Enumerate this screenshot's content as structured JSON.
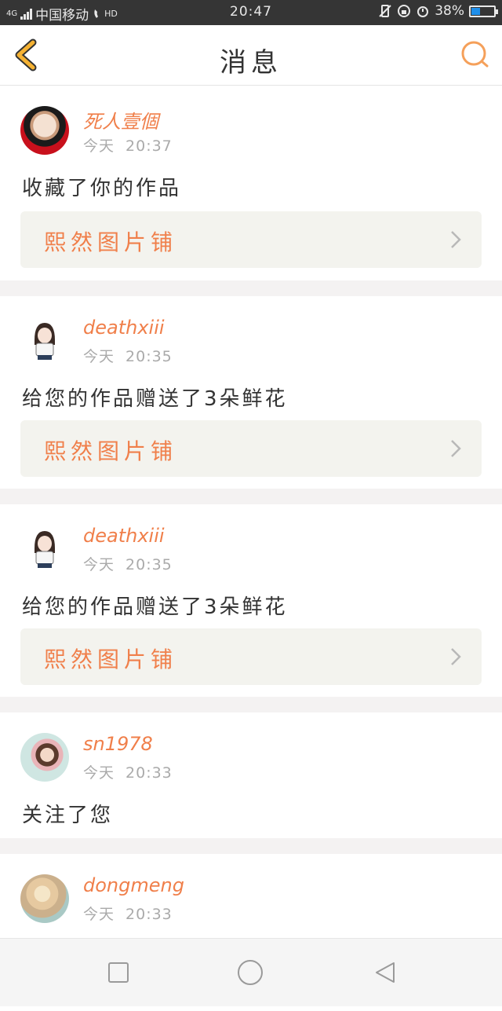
{
  "status_bar": {
    "network": "4G",
    "carrier": "中国移动",
    "hd": "HD",
    "time": "20:47",
    "battery": "38%",
    "battery_level": 0.38
  },
  "header": {
    "title": "消息",
    "back_icon": "chevron-left-icon",
    "search_icon": "search-icon"
  },
  "notifications": [
    {
      "user": "死人壹個",
      "day": "今天",
      "time": "20:37",
      "message": "收藏了你的作品",
      "link": "熙然图片铺",
      "avatar": "red-portrait"
    },
    {
      "user": "deathxiii",
      "day": "今天",
      "time": "20:35",
      "message": "给您的作品赠送了3朵鲜花",
      "link": "熙然图片铺",
      "avatar": "cartoon-girl"
    },
    {
      "user": "deathxiii",
      "day": "今天",
      "time": "20:35",
      "message": "给您的作品赠送了3朵鲜花",
      "link": "熙然图片铺",
      "avatar": "cartoon-girl"
    },
    {
      "user": "sn1978",
      "day": "今天",
      "time": "20:33",
      "message": "关注了您",
      "avatar": "illustrated-girl"
    },
    {
      "user": "dongmeng",
      "day": "今天",
      "time": "20:33",
      "avatar": "flower-photo"
    }
  ],
  "colors": {
    "accent": "#f07f4a",
    "header_icon_accent": "#f5b233",
    "card_link_bg": "#f3f3ee"
  },
  "nav_bar": {
    "icons": [
      "square-recents-icon",
      "circle-home-icon",
      "triangle-back-icon"
    ]
  }
}
